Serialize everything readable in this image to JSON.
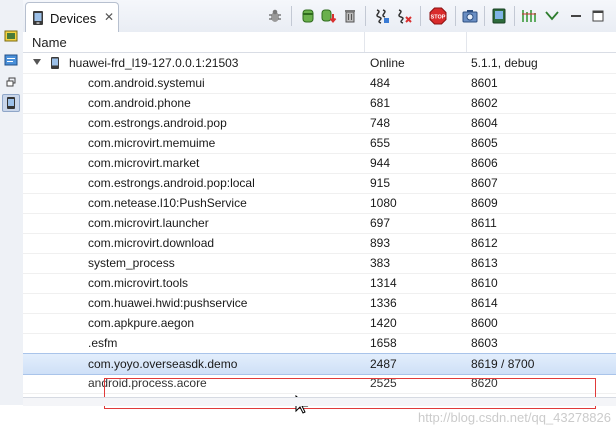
{
  "tab": {
    "label": "Devices",
    "close": "✕"
  },
  "toolbar": {
    "icons": [
      "debug-icon",
      "heap-update-icon",
      "heap-dump-icon",
      "trash-gc-icon",
      "thread-update-icon",
      "method-profiling-icon",
      "stop-process-icon",
      "screen-capture-icon",
      "hierarchy-dump-icon",
      "systrace-icon",
      "view-menu-icon"
    ],
    "stop_label": "STOP"
  },
  "table": {
    "headers": {
      "name": "Name"
    },
    "device": {
      "name": "huawei-frd_l19-127.0.0.1:21503",
      "status": "Online",
      "version": "5.1.1, debug"
    },
    "rows": [
      {
        "name": "com.android.systemui",
        "pid": "484",
        "port": "8601"
      },
      {
        "name": "com.android.phone",
        "pid": "681",
        "port": "8602"
      },
      {
        "name": "com.estrongs.android.pop",
        "pid": "748",
        "port": "8604"
      },
      {
        "name": "com.microvirt.memuime",
        "pid": "655",
        "port": "8605"
      },
      {
        "name": "com.microvirt.market",
        "pid": "944",
        "port": "8606"
      },
      {
        "name": "com.estrongs.android.pop:local",
        "pid": "915",
        "port": "8607"
      },
      {
        "name": "com.netease.l10:PushService",
        "pid": "1080",
        "port": "8609"
      },
      {
        "name": "com.microvirt.launcher",
        "pid": "697",
        "port": "8611"
      },
      {
        "name": "com.microvirt.download",
        "pid": "893",
        "port": "8612"
      },
      {
        "name": "system_process",
        "pid": "383",
        "port": "8613"
      },
      {
        "name": "com.microvirt.tools",
        "pid": "1314",
        "port": "8610"
      },
      {
        "name": "com.huawei.hwid:pushservice",
        "pid": "1336",
        "port": "8614"
      },
      {
        "name": "com.apkpure.aegon",
        "pid": "1420",
        "port": "8600"
      },
      {
        "name": ".esfm",
        "pid": "1658",
        "port": "8603"
      },
      {
        "name": "com.yoyo.overseasdk.demo",
        "pid": "2487",
        "port": "8619 / 8700"
      },
      {
        "name": "android.process.acore",
        "pid": "2525",
        "port": "8620"
      }
    ]
  },
  "watermark": "http://blog.csdn.net/qq_43278826",
  "colors": {
    "highlight_border": "#e03a3a",
    "selection": "#cfe0f7",
    "accent": "#3a6fc4"
  }
}
